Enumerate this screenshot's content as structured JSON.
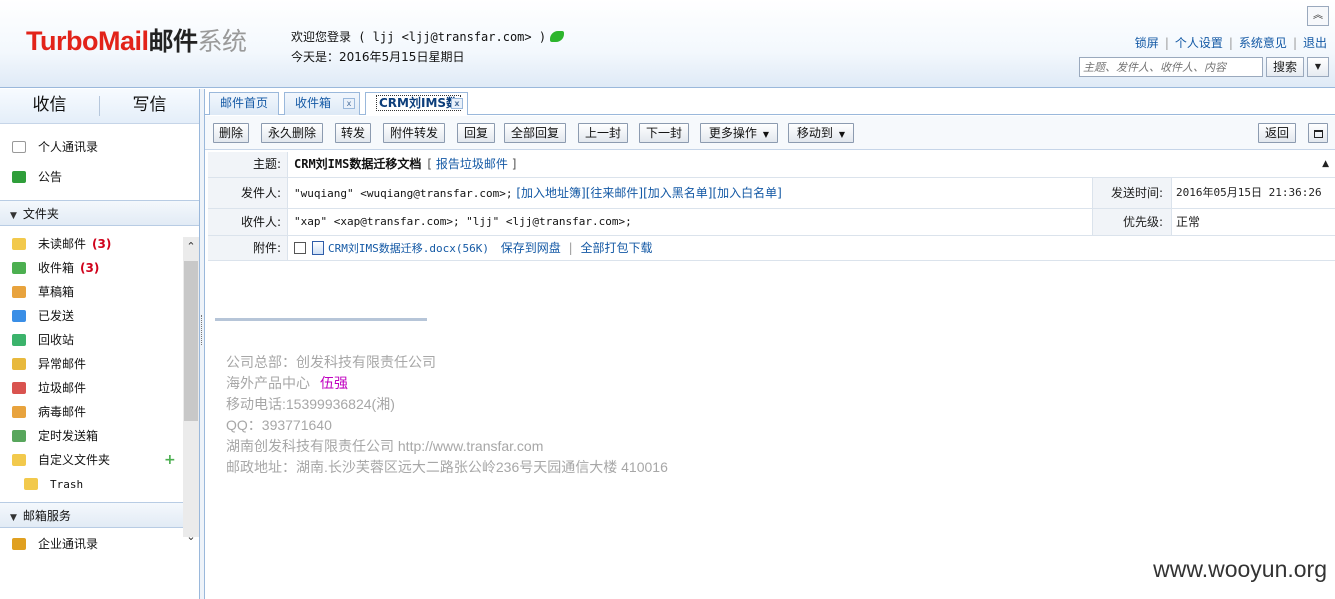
{
  "header": {
    "logo_brand": "TurboMail",
    "logo_cn1": "邮件",
    "logo_cn2": "系统",
    "welcome": "欢迎您登录 ( ljj  <ljj@transfar.com> )",
    "date": "今天是：2016年5月15日星期日",
    "links": [
      "锁屏",
      "个人设置",
      "系统意见",
      "退出"
    ],
    "search_placeholder": "主题、发件人、收件人、内容",
    "search_button": "搜索"
  },
  "sidebar": {
    "receive": "收信",
    "compose": "写信",
    "top_items": [
      {
        "label": "个人通讯录",
        "icon": "contacts-icon"
      },
      {
        "label": "公告",
        "icon": "announcement-icon"
      }
    ],
    "folders_title": "文件夹",
    "folders": [
      {
        "label": "未读邮件",
        "count": "(3)",
        "icon": "unread-folder-icon"
      },
      {
        "label": "收件箱",
        "count": "(3)",
        "icon": "inbox-icon"
      },
      {
        "label": "草稿箱",
        "count": "",
        "icon": "drafts-icon"
      },
      {
        "label": "已发送",
        "count": "",
        "icon": "sent-icon"
      },
      {
        "label": "回收站",
        "count": "",
        "icon": "recycle-bin-icon"
      },
      {
        "label": "异常邮件",
        "count": "",
        "icon": "abnormal-mail-icon"
      },
      {
        "label": "垃圾邮件",
        "count": "",
        "icon": "spam-icon"
      },
      {
        "label": "病毒邮件",
        "count": "",
        "icon": "virus-mail-icon"
      },
      {
        "label": "定时发送箱",
        "count": "",
        "icon": "scheduled-send-icon"
      },
      {
        "label": "自定义文件夹",
        "count": "",
        "icon": "custom-folder-icon"
      }
    ],
    "trash_sub": "Trash",
    "services_title": "邮箱服务",
    "services": [
      {
        "label": "企业通讯录",
        "icon": "enterprise-contacts-icon"
      }
    ]
  },
  "tabs": [
    "邮件首页",
    "收件箱",
    "CRM刘IMS数"
  ],
  "toolbar": {
    "buttons": [
      "删除",
      "永久删除",
      "转发",
      "附件转发",
      "回复",
      "全部回复",
      "上一封",
      "下一封",
      "更多操作",
      "移动到"
    ],
    "back": "返回"
  },
  "mail": {
    "subject_label": "主题:",
    "subject": "CRM刘IMS数据迁移文档",
    "report_spam": "报告垃圾邮件",
    "from_label": "发件人:",
    "from": "\"wuqiang\" <wuqiang@transfar.com>;",
    "from_actions": [
      "[加入地址簿]",
      "[往来邮件]",
      "[加入黑名单]",
      "[加入白名单]"
    ],
    "sent_time_label": "发送时间:",
    "sent_time": "2016年05月15日 21:36:26",
    "to_label": "收件人:",
    "to": "\"xap\" <xap@transfar.com>; \"ljj\" <ljj@transfar.com>;",
    "priority_label": "优先级:",
    "priority": "正常",
    "attachment_label": "附件:",
    "attachment_name": "CRM刘IMS数据迁移.docx(56K)",
    "save_to_disk": "保存到网盘",
    "download_all": "全部打包下载"
  },
  "signature": {
    "line1": "公司总部：创发科技有限责任公司",
    "line2_prefix": "海外产品中心",
    "line2_name": "伍强",
    "line3": "移动电话:15399936824(湘)",
    "line4": "QQ：393771640",
    "line5": "湖南创发科技有限责任公司 http://www.transfar.com",
    "line6": "邮政地址：湖南.长沙芙蓉区远大二路张公岭236号天园通信大楼  410016"
  },
  "watermark": "www.wooyun.org"
}
